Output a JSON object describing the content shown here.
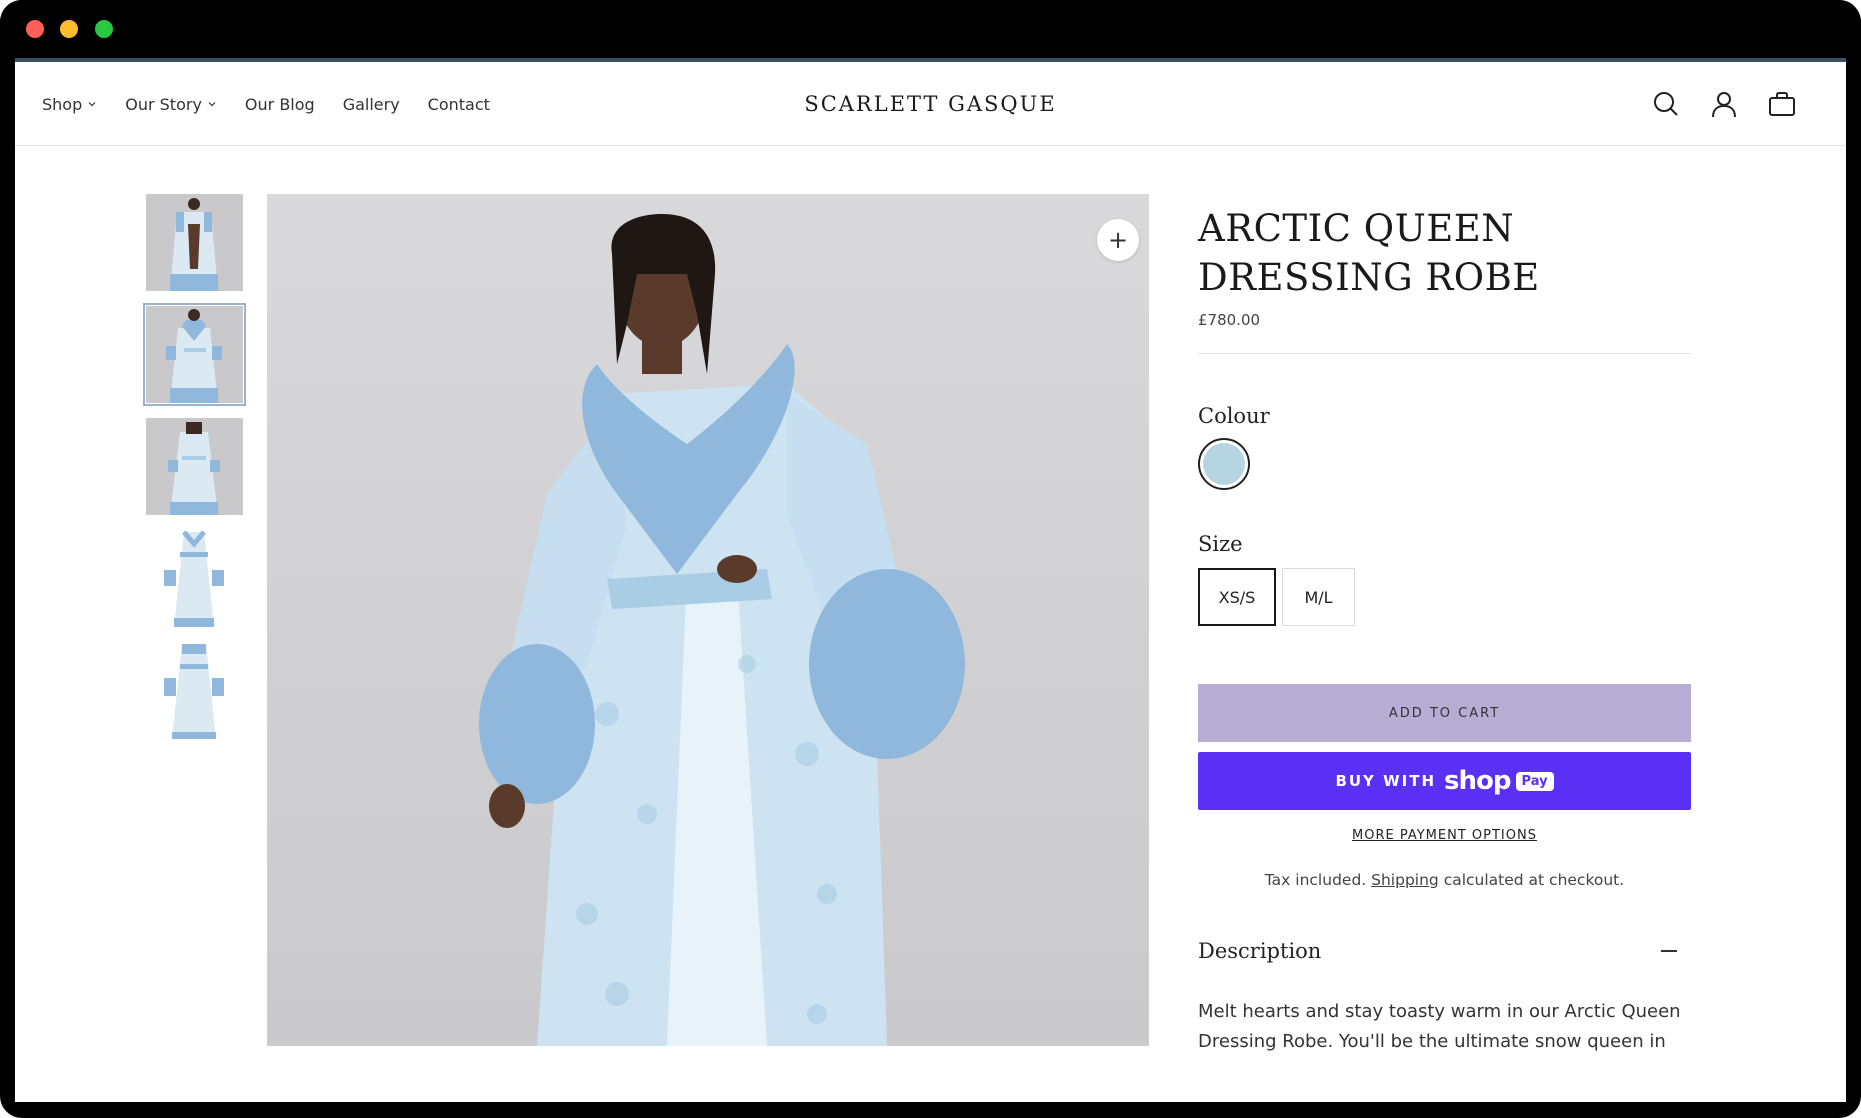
{
  "nav": {
    "items": [
      {
        "label": "Shop",
        "has_dropdown": true
      },
      {
        "label": "Our Story",
        "has_dropdown": true
      },
      {
        "label": "Our Blog",
        "has_dropdown": false
      },
      {
        "label": "Gallery",
        "has_dropdown": false
      },
      {
        "label": "Contact",
        "has_dropdown": false
      }
    ]
  },
  "brand": {
    "name": "SCARLETT GASQUE"
  },
  "header_icons": [
    "search-icon",
    "account-icon",
    "cart-icon"
  ],
  "gallery": {
    "thumbnail_count": 5,
    "active_index": 1,
    "zoom_label": "+"
  },
  "product": {
    "title_line1": "ARCTIC QUEEN",
    "title_line2": "DRESSING ROBE",
    "price": "£780.00",
    "colour_label": "Colour",
    "colour_swatch": "#b5d5e2",
    "size_label": "Size",
    "sizes": [
      "XS/S",
      "M/L"
    ],
    "selected_size": "XS/S",
    "add_to_cart": "ADD TO CART",
    "buy_with": "BUY WITH",
    "shop_word": "shop",
    "pay_badge": "Pay",
    "more_payment": "MORE PAYMENT OPTIONS",
    "tax_prefix": "Tax included. ",
    "tax_link": "Shipping",
    "tax_suffix": " calculated at checkout.",
    "description_heading": "Description",
    "description_text": "Melt hearts and stay toasty warm in our Arctic Queen Dressing Robe. You'll be the ultimate snow queen in this"
  },
  "colors": {
    "add_to_cart_bg": "#b6acd4",
    "shop_pay_bg": "#5a31f4",
    "robe_blue": "#b8d8ec",
    "fur_blue": "#8fb8dc"
  }
}
